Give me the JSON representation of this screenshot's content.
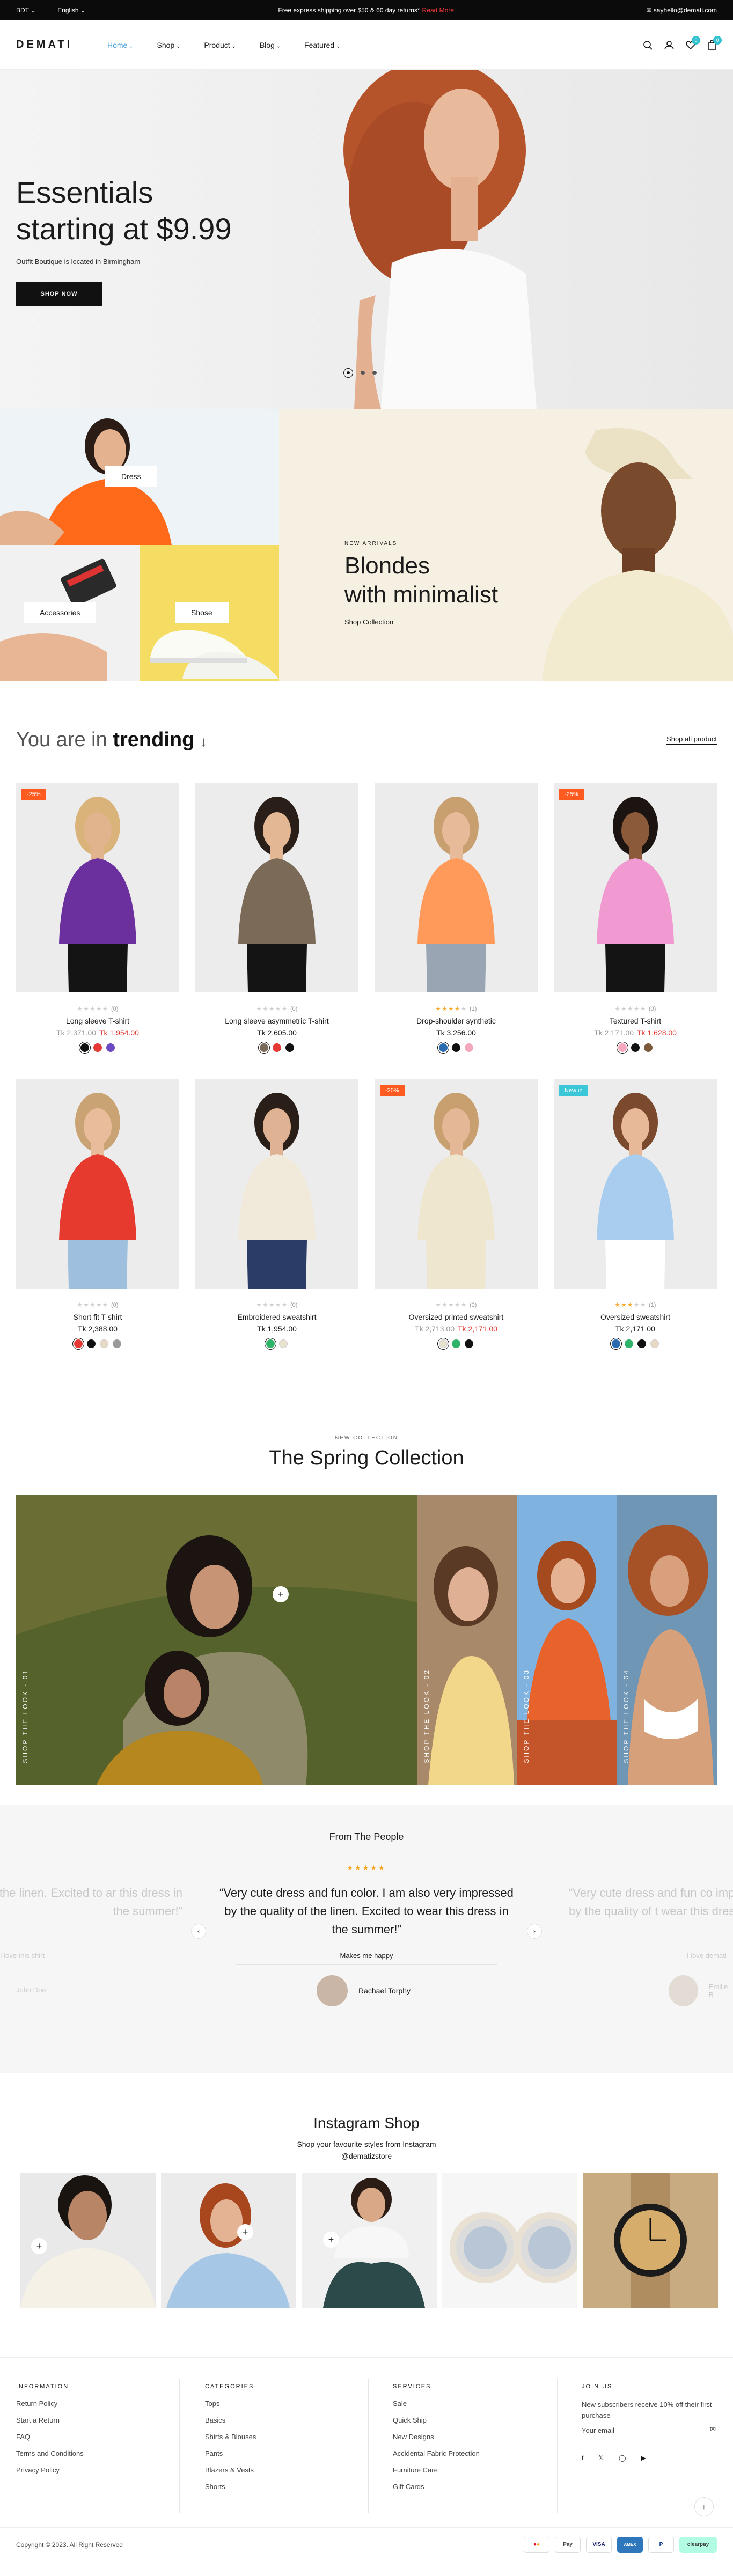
{
  "topbar": {
    "currency": "BDT",
    "language": "English",
    "promo": "Free express shipping over $50 & 60 day returns*",
    "promo_link": "Read More",
    "email": "sayhello@demati.com"
  },
  "header": {
    "logo": "DEMATI",
    "nav": [
      "Home",
      "Shop",
      "Product",
      "Blog",
      "Featured"
    ],
    "wishlist_count": "0",
    "cart_count": "0"
  },
  "hero": {
    "title_line1": "Essentials",
    "title_line2": "starting at $9.99",
    "subtitle": "Outfit Boutique is located in Birmingham",
    "button": "SHOP NOW"
  },
  "banners": {
    "dress": "Dress",
    "accessories": "Accessories",
    "shoe": "Shose",
    "new_tag": "NEW ARRIVALS",
    "new_title_line1": "Blondes",
    "new_title_line2": "with minimalist",
    "new_link": "Shop Collection"
  },
  "trending": {
    "title_prefix": "You are in",
    "title_bold": "trending",
    "shop_all": "Shop all product",
    "products": [
      {
        "name": "Long sleeve T-shirt",
        "old": "Tk 2,371.00",
        "price": "Tk 1,954.00",
        "rating": 0,
        "count": "(0)",
        "label": "-25%",
        "label_color": "#ff5a1f",
        "swatches": [
          "#111111",
          "#e53935",
          "#6a4bc4"
        ]
      },
      {
        "name": "Long sleeve asymmetric T-shirt",
        "old": "",
        "price": "Tk 2,605.00",
        "rating": 0,
        "count": "(0)",
        "label": "",
        "label_color": "",
        "swatches": [
          "#7a6b5b",
          "#e53935",
          "#111111"
        ]
      },
      {
        "name": "Drop-shoulder synthetic",
        "old": "",
        "price": "Tk 3,256.00",
        "rating": 4,
        "count": "(1)",
        "label": "",
        "label_color": "",
        "swatches": [
          "#2b6cb0",
          "#111111",
          "#f4a7bd"
        ]
      },
      {
        "name": "Textured T-shirt",
        "old": "Tk 2,171.00",
        "price": "Tk 1,628.00",
        "rating": 0,
        "count": "(0)",
        "label": "-25%",
        "label_color": "#ff5a1f",
        "swatches": [
          "#f4a7bd",
          "#111111",
          "#7a5a3a"
        ]
      },
      {
        "name": "Short fit T-shirt",
        "old": "",
        "price": "Tk 2,388.00",
        "rating": 0,
        "count": "(0)",
        "label": "",
        "label_color": "",
        "swatches": [
          "#e53935",
          "#111111",
          "#e8d9c4",
          "#9a9a9a"
        ]
      },
      {
        "name": "Embroidered sweatshirt",
        "old": "",
        "price": "Tk 1,954.00",
        "rating": 0,
        "count": "(0)",
        "label": "",
        "label_color": "",
        "swatches": [
          "#2fb36a",
          "#e8e2cf"
        ]
      },
      {
        "name": "Oversized printed sweatshirt",
        "old": "Tk 2,713.00",
        "price": "Tk 2,171.00",
        "rating": 0,
        "count": "(0)",
        "label": "-20%",
        "label_color": "#ff5a1f",
        "swatches": [
          "#e8e2cf",
          "#2fb36a",
          "#111111"
        ]
      },
      {
        "name": "Oversized sweatshirt",
        "old": "",
        "price": "Tk 2,171.00",
        "rating": 3,
        "count": "(1)",
        "label": "New in",
        "label_color": "#3cc7d8",
        "swatches": [
          "#2b6cb0",
          "#2fb36a",
          "#111111",
          "#e8d9c4"
        ]
      }
    ]
  },
  "spring": {
    "tag": "NEW COLLECTION",
    "title": "The Spring Collection",
    "panels": [
      "SHOP THE LOOK - 01",
      "SHOP THE LOOK - 02",
      "SHOP THE LOOK - 03",
      "SHOP THE LOOK - 04"
    ]
  },
  "testimonial": {
    "heading": "From The People",
    "quote": "“Very cute dress and fun color. I am also very impressed by the quality of the linen. Excited to wear this dress in the summer!”",
    "ghost_left": "lity of the linen. Excited to ar this dress in the summer!”",
    "ghost_right": "“Very cute dress and fun co impressed by the quality of t wear this dress in th",
    "caption": "Makes me happy",
    "ghost_left_caption": "I love this shirt",
    "ghost_right_caption": "I love demati",
    "person": "Rachael Torphy",
    "left_person": "John Doe",
    "right_person": "Emilie B"
  },
  "instagram": {
    "title": "Instagram Shop",
    "subtitle": "Shop your favourite styles from Instagram",
    "handle": "@dematizstore"
  },
  "footer": {
    "information": {
      "title": "INFORMATION",
      "items": [
        "Return Policy",
        "Start a Return",
        "FAQ",
        "Terms and Conditions",
        "Privacy Policy"
      ]
    },
    "categories": {
      "title": "CATEGORIES",
      "items": [
        "Tops",
        "Basics",
        "Shirts & Blouses",
        "Pants",
        "Blazers & Vests",
        "Shorts"
      ]
    },
    "services": {
      "title": "SERVICES",
      "items": [
        "Sale",
        "Quick Ship",
        "New Designs",
        "Accidental Fabric Protection",
        "Furniture Care",
        "Gift Cards"
      ]
    },
    "join": {
      "title": "JOIN US",
      "text": "New subscribers receive 10% off their first purchase",
      "email_placeholder": "Your email"
    },
    "copyright": "Copyright © 2023. All Right Reserved",
    "payments": [
      "MC",
      "Pay",
      "VISA",
      "AMEX",
      "P",
      "clearpay"
    ]
  }
}
